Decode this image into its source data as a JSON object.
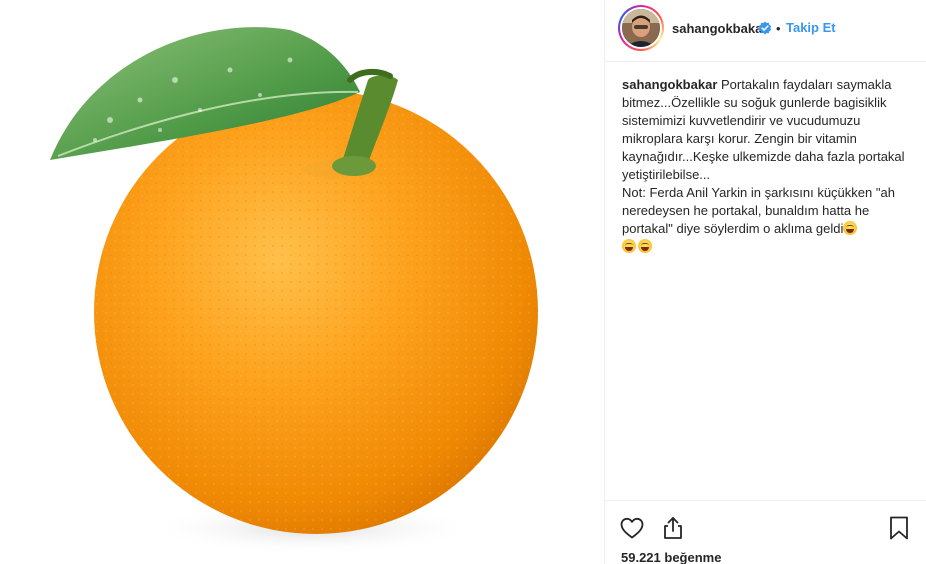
{
  "post": {
    "image_subject": "orange-with-leaf",
    "author": {
      "username": "sahangokbakar",
      "verified": true,
      "separator": "•",
      "follow_label": "Takip Et"
    },
    "caption": {
      "username": "sahangokbakar",
      "text": "Portakalın faydaları saymakla bitmez...Özellikle su soğuk gunlerde bagisiklik sistemimizi kuvvetlendirir ve vucudumuzu mikroplara karşı korur. Zengin bir vitamin kaynağıdır...Keşke ulkemizde daha fazla portakal yetiştirilebilse...\nNot: Ferda Anil Yarkin in şarkısını küçükken \"ah neredeysen he portakal, bunaldım hatta he portakal\" diye söylerdim o aklıma geldi",
      "emojis": [
        "grinning-squinting-face",
        "grinning-squinting-face",
        "grinning-squinting-face"
      ]
    },
    "actions": {
      "icons": [
        "heart-icon",
        "share-icon",
        "bookmark-icon"
      ]
    },
    "likes_label": "59.221 beğenme"
  },
  "colors": {
    "accent": "#3897f0",
    "text": "#262626",
    "border": "#efefef"
  }
}
